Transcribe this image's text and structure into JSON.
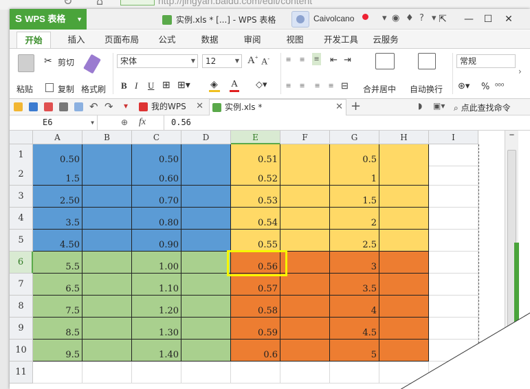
{
  "browser": {
    "url": "http://jingyan.baidu.com/edit/content"
  },
  "app": {
    "name": "WPS 表格",
    "doc_title": "实例.xls * [...] - WPS 表格",
    "username": "Caivolcano"
  },
  "tabs": [
    "开始",
    "插入",
    "页面布局",
    "公式",
    "数据",
    "审阅",
    "视图",
    "开发工具",
    "云服务"
  ],
  "ribbon": {
    "paste": "粘贴",
    "cut": "剪切",
    "copy": "复制",
    "format_painter": "格式刷",
    "font_name": "宋体",
    "font_size": "12",
    "merge_center": "合并居中",
    "wrap_text": "自动换行",
    "number_format": "常规",
    "percent": "%"
  },
  "doc_tabs": [
    {
      "label": "我的WPS"
    },
    {
      "label": "实例.xls *"
    }
  ],
  "search_label": "点此查找命令",
  "formula_bar": {
    "cell_ref": "E6",
    "fx": "fx",
    "value": "0.56"
  },
  "columns": [
    "A",
    "B",
    "C",
    "D",
    "E",
    "F",
    "G",
    "H",
    "I"
  ],
  "rows": [
    "1",
    "2",
    "3",
    "4",
    "5",
    "6",
    "7",
    "8",
    "9",
    "10",
    "11"
  ],
  "cells": {
    "A": [
      "0.50",
      "1.5",
      "2.50",
      "3.5",
      "4.50",
      "5.5",
      "6.5",
      "7.5",
      "8.5",
      "9.5"
    ],
    "C": [
      "0.50",
      "0.60",
      "0.70",
      "0.80",
      "0.90",
      "1.00",
      "1.10",
      "1.20",
      "1.30",
      "1.40"
    ],
    "E": [
      "0.51",
      "0.52",
      "0.53",
      "0.54",
      "0.55",
      "0.56",
      "0.57",
      "0.58",
      "0.59",
      "0.6"
    ],
    "G": [
      "0.5",
      "1",
      "1.5",
      "2",
      "2.5",
      "3",
      "3.5",
      "4",
      "4.5",
      "5"
    ]
  },
  "colors": {
    "blue": "#5b9bd5",
    "green": "#a9d08e",
    "yellow": "#ffd966",
    "orange": "#ed7d31",
    "accent": "#4aa43b",
    "highlight": "#f7f700"
  }
}
